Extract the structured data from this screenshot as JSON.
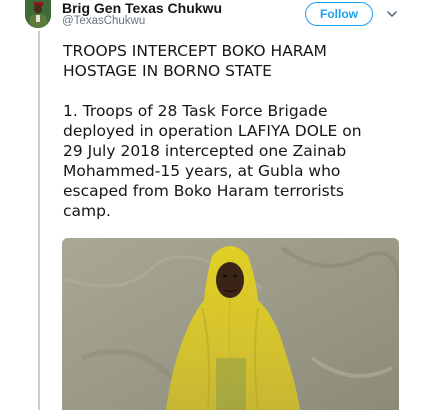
{
  "author": {
    "name": "Brig Gen Texas Chukwu",
    "handle": "@TexasChukwu"
  },
  "actions": {
    "follow_label": "Follow"
  },
  "tweet": {
    "headline_line1": "TROOPS INTERCEPT BOKO HARAM",
    "headline_line2": "HOSTAGE IN BORNO STATE",
    "body_line1": "1. Troops of  28 Task Force Brigade",
    "body_line2": "deployed in operation LAFIYA DOLE on",
    "body_line3": "29 July 2018 intercepted one Zainab",
    "body_line4": "Mohammed-15 years, at Gubla who",
    "body_line5": "escaped from Boko Haram terrorists",
    "body_line6": "camp."
  },
  "colors": {
    "accent": "#1da1f2",
    "text": "#14171a",
    "muted": "#657786",
    "thread_line": "#c4cfd6"
  },
  "icons": {
    "caret": "chevron-down-icon"
  }
}
